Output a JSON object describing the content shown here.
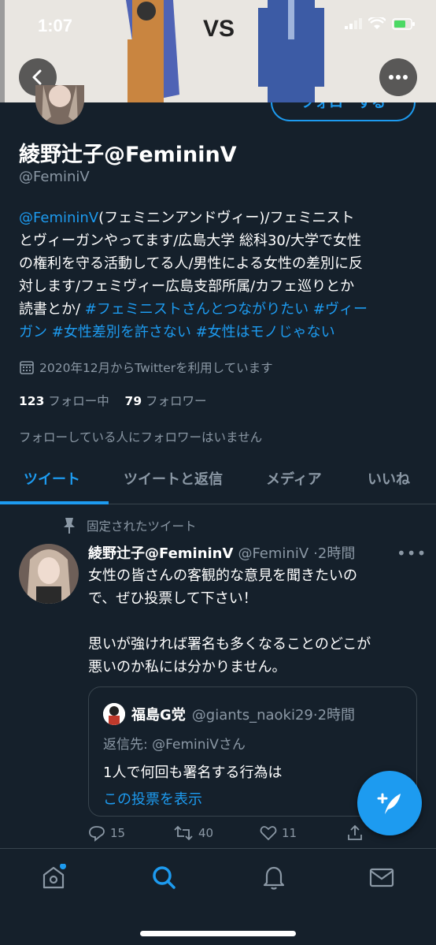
{
  "status_bar": {
    "time": "1:07"
  },
  "banner": {
    "vs_text": "VS"
  },
  "profile": {
    "follow_label": "フォローする",
    "display_name": "綾野辻子@FemininV",
    "handle": "@FeminiV",
    "bio": {
      "line1_link": "@FemininV",
      "line1_text": "(フェミニンアンドヴィー)/フェミニスト",
      "line2": "とヴィーガンやってます/広島大学 総科30/大学で女性",
      "line3": "の権利を守る活動してる人/男性による女性の差別に反",
      "line4": "対します/フェミヴィー広島支部所属/カフェ巡りとか",
      "line5_text": "読書とか/ ",
      "line5_tag1": "#フェミニストさんとつながりたい",
      "line5_tag2": "#ヴィー",
      "line6_tag2": "ガン",
      "line6_tag3": "#女性差別を許さない",
      "line6_tag4": "#女性はモノじゃない"
    },
    "joined": "2020年12月からTwitterを利用しています",
    "following_count": "123",
    "following_label": "フォロー中",
    "followers_count": "79",
    "followers_label": "フォロワー",
    "no_mutual_followers": "フォローしている人にフォロワーはいません"
  },
  "tabs": [
    {
      "label": "ツイート",
      "active": true
    },
    {
      "label": "ツイートと返信"
    },
    {
      "label": "メディア"
    },
    {
      "label": "いいね"
    }
  ],
  "tweet": {
    "pinned_label": "固定されたツイート",
    "author_name": "綾野辻子@FemininV",
    "author_handle": "@FeminiV",
    "time": "·2時間",
    "more": "•••",
    "body_line1": "女性の皆さんの客観的な意見を聞きたいの",
    "body_line2": "で、ぜひ投票して下さい！",
    "body_line3": "思いが強ければ署名も多くなることのどこが",
    "body_line4": "悪いのか私には分かりません。",
    "quote": {
      "author_name": "福島G党",
      "author_handle": "@giants_naoki29",
      "time": "·2時間",
      "reply_to": "返信先: @FeminiVさん",
      "text": "1人で何回も署名する行為は",
      "link": "この投票を表示"
    },
    "replies": "15",
    "retweets": "40",
    "likes": "11"
  },
  "colors": {
    "background": "#15202b",
    "accent": "#1d9bf0",
    "muted": "#8b98a5",
    "border": "#38444d"
  },
  "icons": [
    "back-arrow-icon",
    "more-icon",
    "calendar-icon",
    "pin-icon",
    "reply-icon",
    "retweet-icon",
    "like-icon",
    "share-icon",
    "compose-icon",
    "home-icon",
    "search-icon",
    "notifications-icon",
    "messages-icon"
  ]
}
